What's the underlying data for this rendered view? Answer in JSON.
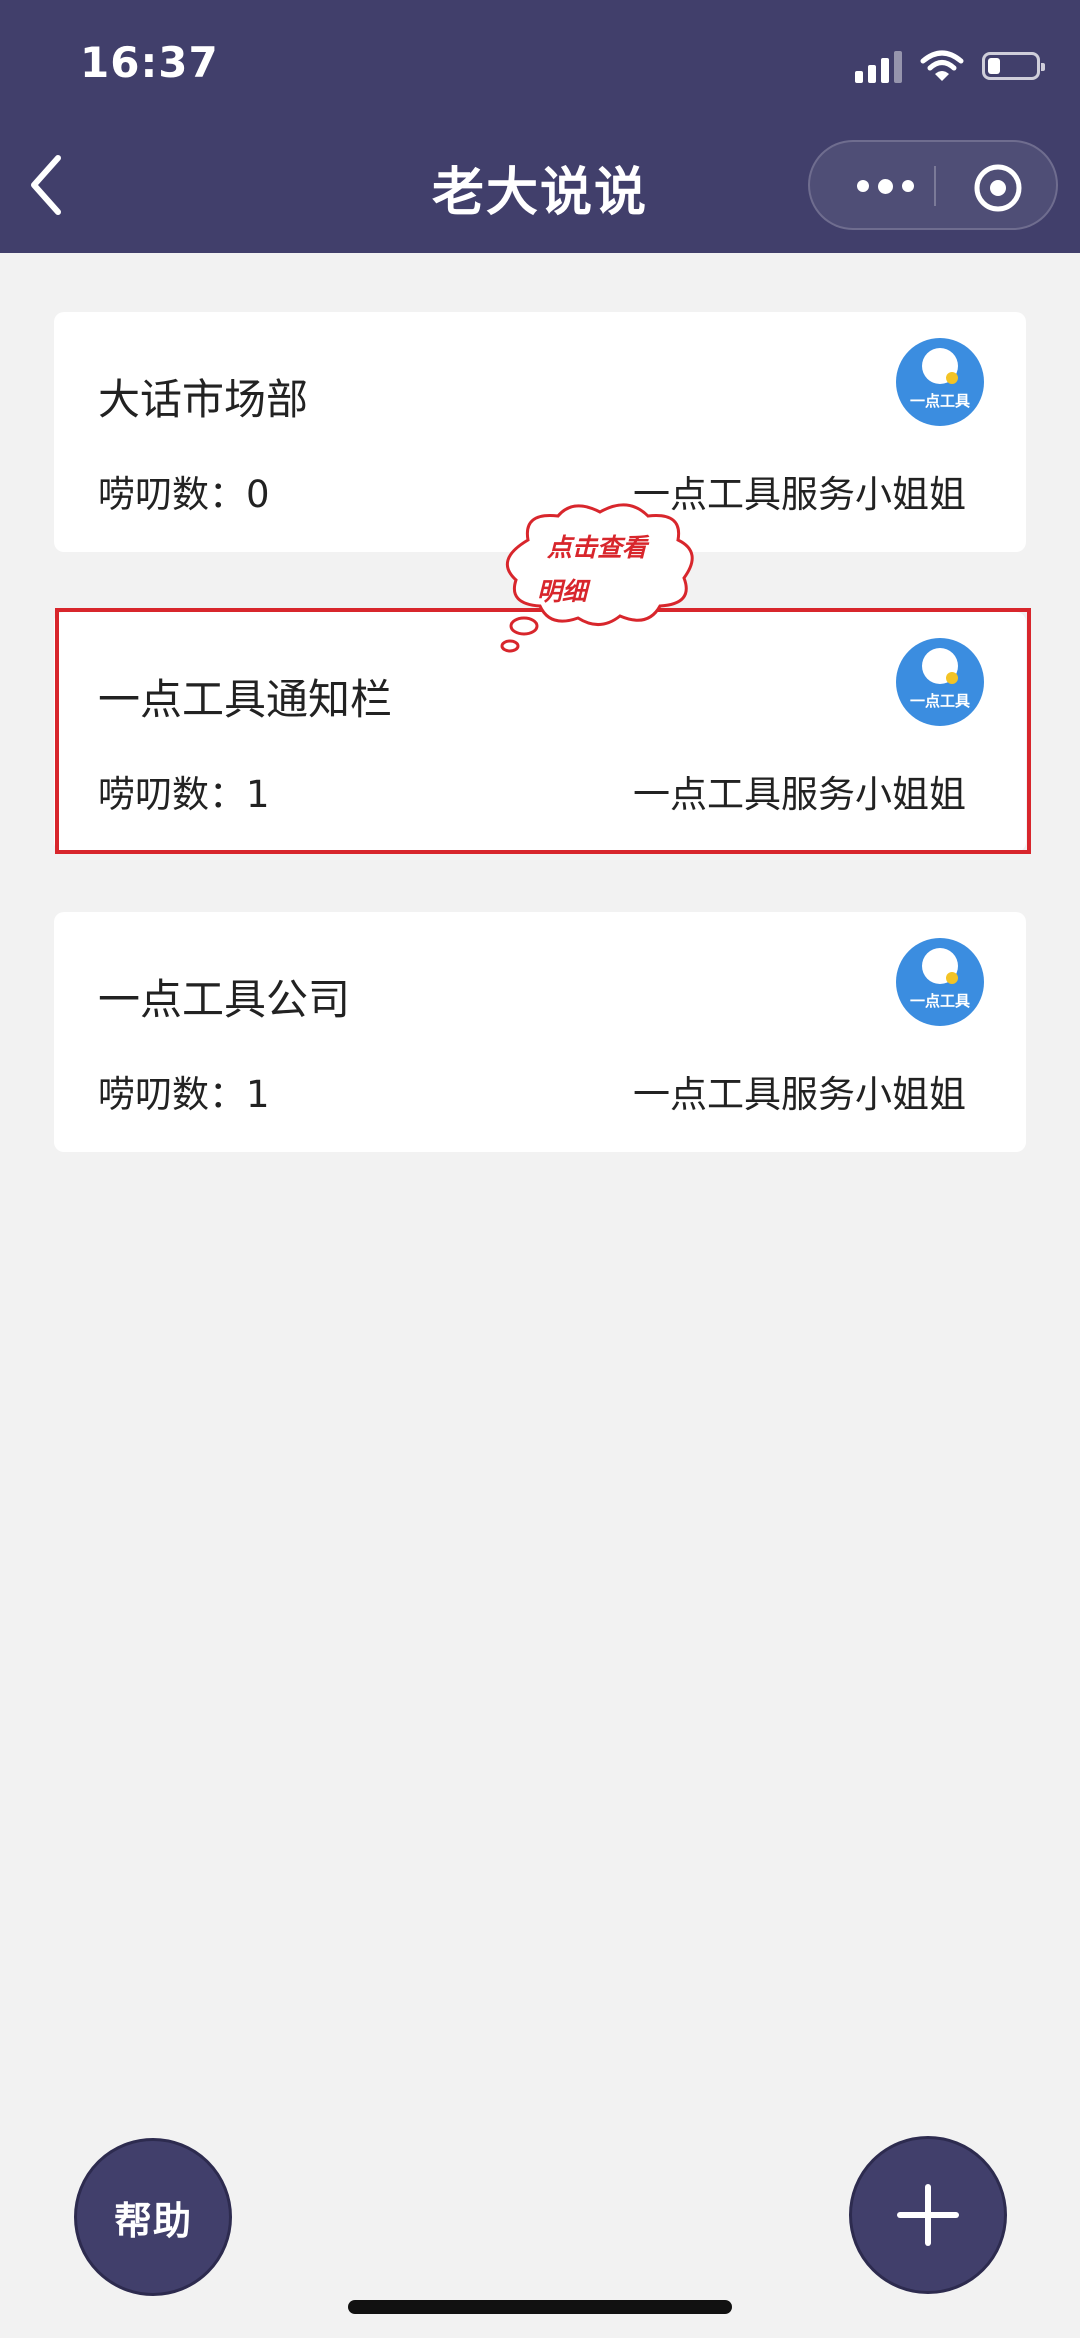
{
  "status_bar": {
    "time": "16:37"
  },
  "nav": {
    "title": "老大说说"
  },
  "cards": [
    {
      "title": "大话市场部",
      "count": "唠叨数：0",
      "author": "一点工具服务小姐姐",
      "logo_text": "一点工具"
    },
    {
      "title": "一点工具通知栏",
      "count": "唠叨数：1",
      "author": "一点工具服务小姐姐",
      "logo_text": "一点工具"
    },
    {
      "title": "一点工具公司",
      "count": "唠叨数：1",
      "author": "一点工具服务小姐姐",
      "logo_text": "一点工具"
    }
  ],
  "hint": {
    "line1": "点击查看",
    "line2": "明细"
  },
  "buttons": {
    "help_label": "帮助"
  },
  "colors": {
    "header_bg": "#413f6b",
    "page_bg": "#f2f2f2",
    "logo_bg": "#3b8de0",
    "highlight": "#d8262c"
  },
  "icons": {
    "back": "chevron-left-icon",
    "more": "more-dots-icon",
    "close": "target-close-icon",
    "add": "plus-icon"
  }
}
